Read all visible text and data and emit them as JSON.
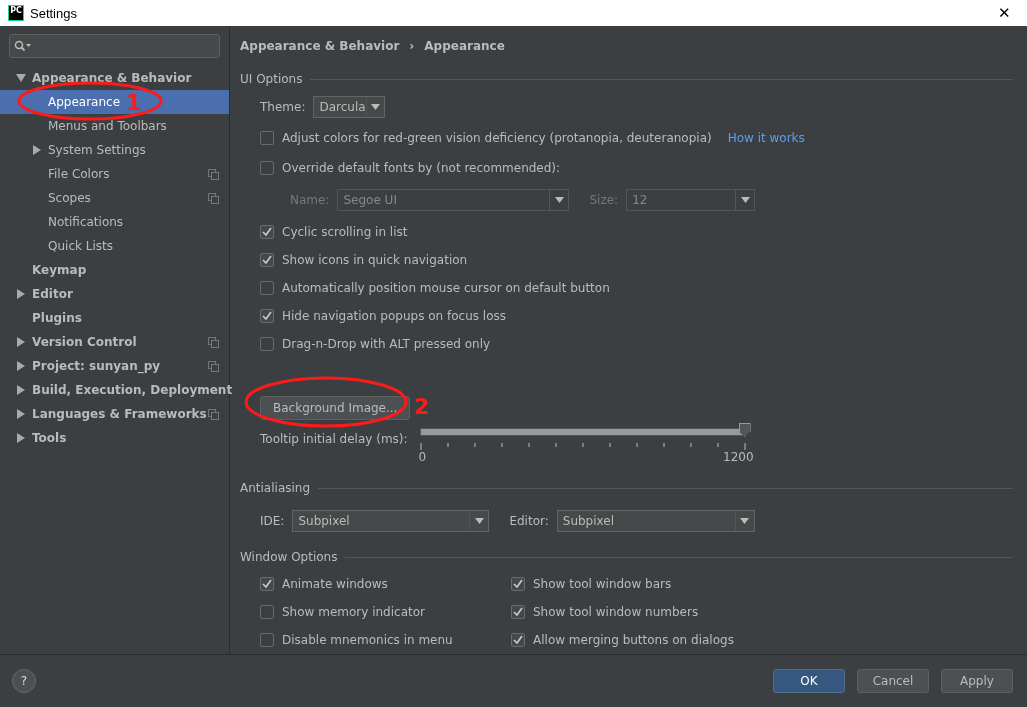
{
  "window": {
    "title": "Settings",
    "app_badge": "PC",
    "close": "✕"
  },
  "sidebar": {
    "items": [
      {
        "label": "Appearance & Behavior",
        "bold": true,
        "expanded": true,
        "selected": false,
        "shared": false,
        "children": [
          {
            "label": "Appearance",
            "selected": true,
            "shared": false,
            "annotation": "1"
          },
          {
            "label": "Menus and Toolbars",
            "selected": false,
            "shared": false
          },
          {
            "label": "System Settings",
            "selected": false,
            "shared": false,
            "expanded": false
          },
          {
            "label": "File Colors",
            "selected": false,
            "shared": true
          },
          {
            "label": "Scopes",
            "selected": false,
            "shared": true
          },
          {
            "label": "Notifications",
            "selected": false,
            "shared": false
          },
          {
            "label": "Quick Lists",
            "selected": false,
            "shared": false
          }
        ]
      },
      {
        "label": "Keymap",
        "bold": true,
        "selected": false,
        "shared": false
      },
      {
        "label": "Editor",
        "bold": true,
        "expanded": false,
        "selected": false,
        "shared": false
      },
      {
        "label": "Plugins",
        "bold": true,
        "selected": false,
        "shared": false
      },
      {
        "label": "Version Control",
        "bold": true,
        "expanded": false,
        "selected": false,
        "shared": true
      },
      {
        "label": "Project: sunyan_py",
        "bold": true,
        "expanded": false,
        "selected": false,
        "shared": true
      },
      {
        "label": "Build, Execution, Deployment",
        "bold": true,
        "expanded": false,
        "selected": false,
        "shared": false
      },
      {
        "label": "Languages & Frameworks",
        "bold": true,
        "expanded": false,
        "selected": false,
        "shared": true
      },
      {
        "label": "Tools",
        "bold": true,
        "expanded": false,
        "selected": false,
        "shared": false
      }
    ]
  },
  "breadcrumb": [
    "Appearance & Behavior",
    "Appearance"
  ],
  "breadcrumb_separator": "›",
  "ui_options": {
    "title": "UI Options",
    "theme": {
      "label": "Theme:",
      "value": "Darcula"
    },
    "rows": [
      {
        "kind": "checkbox",
        "label": "Adjust colors for red-green vision deficiency (protanopia, deuteranopia)",
        "checked": false,
        "link": "How it works"
      },
      {
        "kind": "checkbox",
        "label": "Override default fonts by (not recommended):",
        "checked": false
      },
      {
        "kind": "font",
        "name_label": "Name:",
        "name_value": "Segoe UI",
        "size_label": "Size:",
        "size_value": "12",
        "disabled": true
      },
      {
        "kind": "checkbox",
        "label": "Cyclic scrolling in list",
        "checked": true
      },
      {
        "kind": "checkbox",
        "label": "Show icons in quick navigation",
        "checked": true
      },
      {
        "kind": "checkbox",
        "label": "Automatically position mouse cursor on default button",
        "checked": false
      },
      {
        "kind": "checkbox",
        "label": "Hide navigation popups on focus loss",
        "checked": true
      },
      {
        "kind": "checkbox",
        "label": "Drag-n-Drop with ALT pressed only",
        "checked": false
      }
    ],
    "background_button": {
      "label": "Background Image...",
      "annotation": "2"
    },
    "tooltip_delay": {
      "label": "Tooltip initial delay (ms):",
      "level": 1,
      "min": "0",
      "max": "1200"
    }
  },
  "antialiasing": {
    "title": "Antialiasing",
    "ide_label": "IDE:",
    "ide_value": "Subpixel",
    "editor_label": "Editor:",
    "editor_value": "Subpixel"
  },
  "window_options": {
    "title": "Window Options",
    "rows": [
      [
        {
          "label": "Animate windows",
          "checked": true
        },
        {
          "label": "Show tool window bars",
          "checked": true
        }
      ],
      [
        {
          "label": "Show memory indicator",
          "checked": false
        },
        {
          "label": "Show tool window numbers",
          "checked": true
        }
      ],
      [
        {
          "label": "Disable mnemonics in menu",
          "checked": false
        },
        {
          "label": "Allow merging buttons on dialogs",
          "checked": true
        }
      ]
    ]
  },
  "help": "?",
  "buttons": [
    {
      "label": "OK",
      "primary": true
    },
    {
      "label": "Cancel",
      "primary": false
    },
    {
      "label": "Apply",
      "primary": false
    }
  ]
}
